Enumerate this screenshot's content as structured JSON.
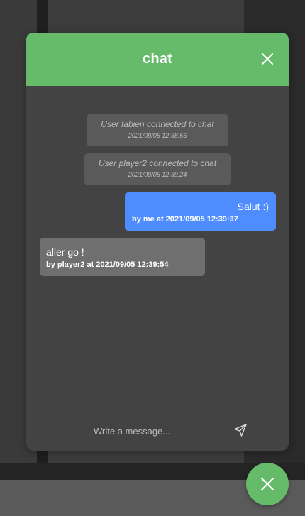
{
  "chat": {
    "title": "chat",
    "close_icon": "close-icon",
    "system_messages": [
      {
        "text": "User fabien connected to chat",
        "time": "2021/09/05 12:38:56"
      },
      {
        "text": "User player2 connected to chat",
        "time": "2021/09/05 12:39:24"
      }
    ],
    "messages": [
      {
        "from": "me",
        "text": "Salut :)",
        "meta": "by me at 2021/09/05 12:39:37"
      },
      {
        "from": "player2",
        "text": "aller go !",
        "meta": "by player2 at 2021/09/05 12:39:54"
      }
    ],
    "composer": {
      "placeholder": "Write a message...",
      "value": "",
      "send_icon": "send-icon"
    }
  },
  "fab": {
    "icon": "close-icon"
  },
  "colors": {
    "accent_green": "#66bb6a",
    "my_bubble": "#4f8dff",
    "other_bubble": "#6f6f6f",
    "system_bubble": "#5a5a5a",
    "panel_bg": "#434343"
  }
}
